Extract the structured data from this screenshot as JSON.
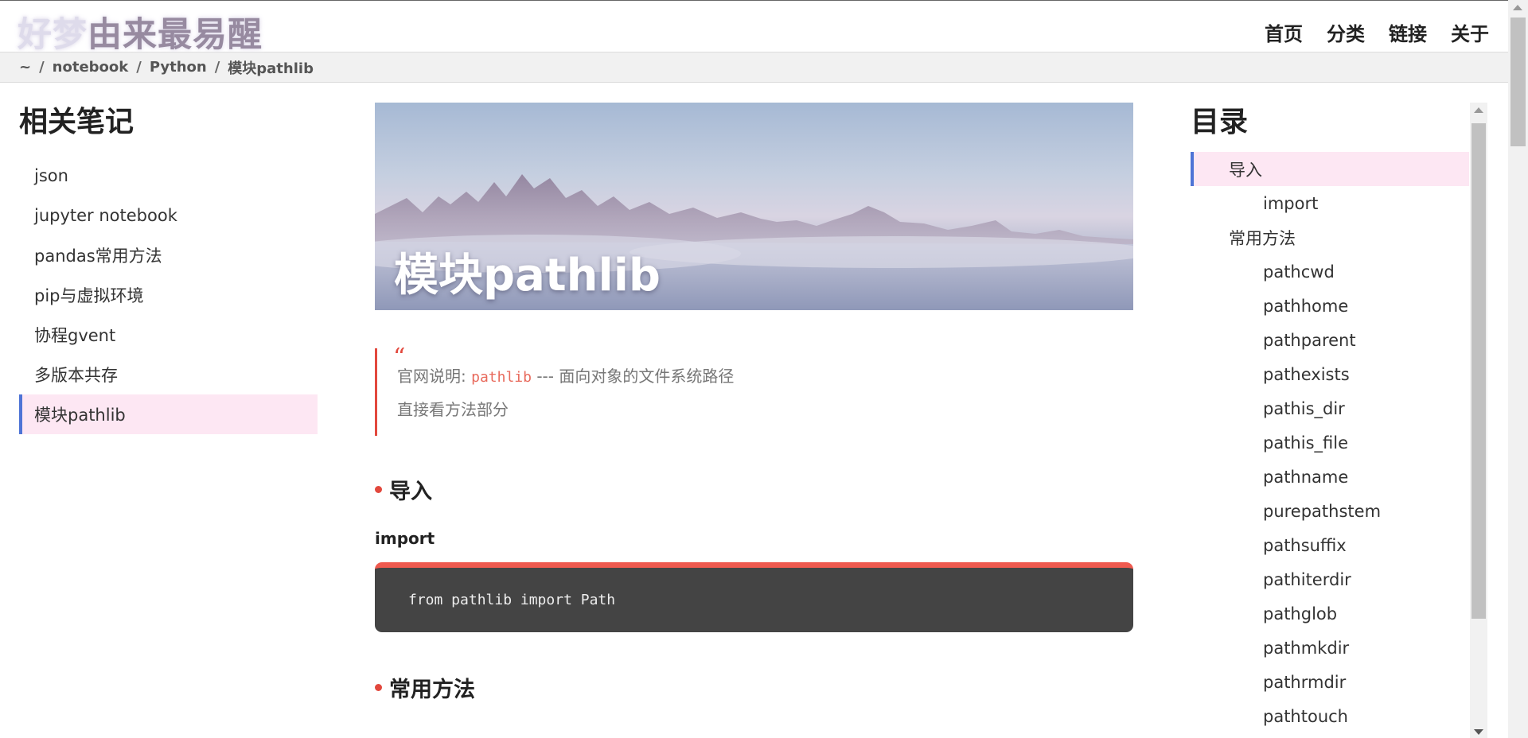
{
  "header": {
    "site_title_dim": "好梦",
    "site_title_bold": "由来最易醒",
    "nav": [
      "首页",
      "分类",
      "链接",
      "关于"
    ]
  },
  "breadcrumb": {
    "items": [
      "~",
      "notebook",
      "Python",
      "模块pathlib"
    ],
    "separator": "/"
  },
  "left_sidebar": {
    "title": "相关笔记",
    "items": [
      "json",
      "jupyter notebook",
      "pandas常用方法",
      "pip与虚拟环境",
      "协程gvent",
      "多版本共存",
      "模块pathlib"
    ],
    "active_index": 6
  },
  "main": {
    "hero_title": "模块pathlib",
    "quote": {
      "mark": "“",
      "line1_prefix": "官网说明: ",
      "line1_code": "pathlib",
      "line1_suffix": " --- 面向对象的文件系统路径",
      "line2": "直接看方法部分"
    },
    "section1": "导入",
    "subsection1": "import",
    "code1": "from pathlib import Path",
    "section2": "常用方法"
  },
  "toc": {
    "title": "目录",
    "entries": [
      {
        "label": "导入",
        "level": 1
      },
      {
        "label": "import",
        "level": 2
      },
      {
        "label": "常用方法",
        "level": 1
      },
      {
        "label": "pathcwd",
        "level": 2
      },
      {
        "label": "pathhome",
        "level": 2
      },
      {
        "label": "pathparent",
        "level": 2
      },
      {
        "label": "pathexists",
        "level": 2
      },
      {
        "label": "pathis_dir",
        "level": 2
      },
      {
        "label": "pathis_file",
        "level": 2
      },
      {
        "label": "pathname",
        "level": 2
      },
      {
        "label": "purepathstem",
        "level": 2
      },
      {
        "label": "pathsuffix",
        "level": 2
      },
      {
        "label": "pathiterdir",
        "level": 2
      },
      {
        "label": "pathglob",
        "level": 2
      },
      {
        "label": "pathmkdir",
        "level": 2
      },
      {
        "label": "pathrmdir",
        "level": 2
      },
      {
        "label": "pathtouch",
        "level": 2
      }
    ],
    "active_index": 0
  },
  "colors": {
    "accent_red": "#e2483d",
    "active_bg": "#fde7f3",
    "active_border": "#4e74d6",
    "code_bg": "#444444"
  }
}
